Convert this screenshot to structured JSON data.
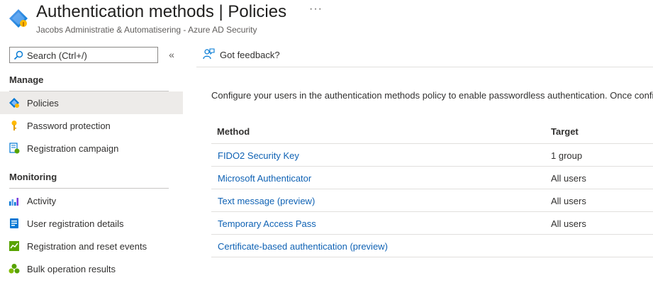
{
  "header": {
    "title": "Authentication methods",
    "separator": "|",
    "title_suffix": "Policies",
    "more": "···",
    "subtitle": "Jacobs Administratie & Automatisering - Azure AD Security",
    "icon": "authentication-methods-icon"
  },
  "sidebar": {
    "search": {
      "placeholder": "Search (Ctrl+/)",
      "icon": "search-icon"
    },
    "collapse": "«",
    "sections": [
      {
        "title": "Manage",
        "items": [
          {
            "label": "Policies",
            "icon": "policy-diamond-icon",
            "selected": true
          },
          {
            "label": "Password protection",
            "icon": "key-icon",
            "selected": false
          },
          {
            "label": "Registration campaign",
            "icon": "registration-icon",
            "selected": false
          }
        ]
      },
      {
        "title": "Monitoring",
        "items": [
          {
            "label": "Activity",
            "icon": "activity-chart-icon",
            "selected": false
          },
          {
            "label": "User registration details",
            "icon": "user-details-icon",
            "selected": false
          },
          {
            "label": "Registration and reset events",
            "icon": "events-icon",
            "selected": false
          },
          {
            "label": "Bulk operation results",
            "icon": "bulk-results-icon",
            "selected": false
          }
        ]
      }
    ]
  },
  "toolbar": {
    "feedback_label": "Got feedback?",
    "feedback_icon": "feedback-icon"
  },
  "main": {
    "description": "Configure your users in the authentication methods policy to enable passwordless authentication. Once confi",
    "table": {
      "columns": [
        "Method",
        "Target"
      ],
      "rows": [
        {
          "method": "FIDO2 Security Key",
          "target": "1 group"
        },
        {
          "method": "Microsoft Authenticator",
          "target": "All users"
        },
        {
          "method": "Text message (preview)",
          "target": "All users"
        },
        {
          "method": "Temporary Access Pass",
          "target": "All users"
        },
        {
          "method": "Certificate-based authentication (preview)",
          "target": ""
        }
      ]
    }
  },
  "colors": {
    "link": "#0f62b4",
    "selected_bg": "#edebe9",
    "text": "#323130",
    "azure_blue": "#0078d4"
  }
}
